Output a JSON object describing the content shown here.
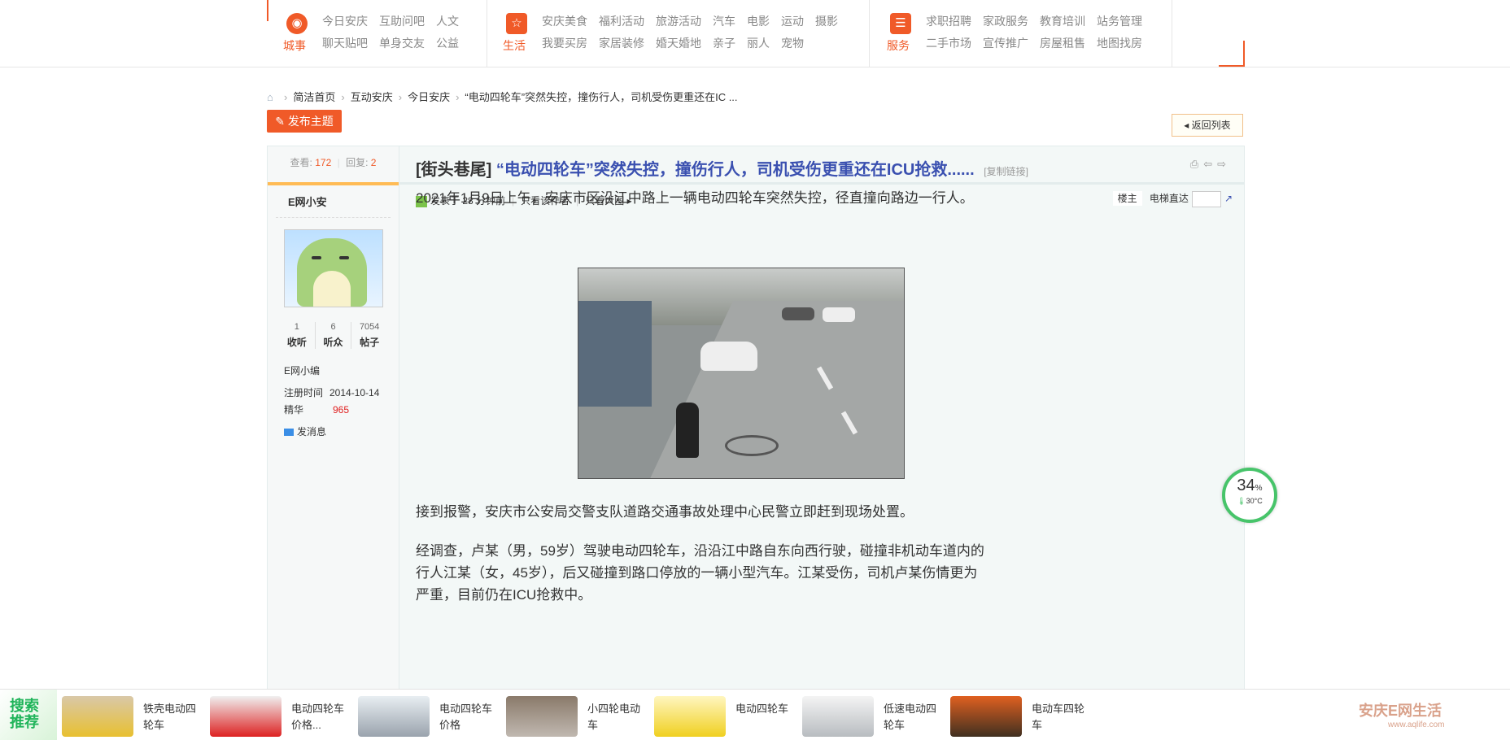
{
  "nav": {
    "groups": [
      {
        "category": "城事",
        "icon": "city-icon",
        "links": [
          "今日安庆",
          "互助问吧",
          "人文",
          "聊天贴吧",
          "单身交友",
          "公益"
        ]
      },
      {
        "category": "生活",
        "icon": "star-icon",
        "links": [
          "安庆美食",
          "福利活动",
          "旅游活动",
          "汽车",
          "电影",
          "运动",
          "摄影",
          "我要买房",
          "家居装修",
          "婚天婚地",
          "亲子",
          "丽人",
          "宠物"
        ]
      },
      {
        "category": "服务",
        "icon": "list-icon",
        "links": [
          "求职招聘",
          "家政服务",
          "教育培训",
          "站务管理",
          "二手市场",
          "宣传推广",
          "房屋租售",
          "地图找房"
        ]
      }
    ]
  },
  "breadcrumb": [
    "简洁首页",
    "互动安庆",
    "今日安庆",
    "“电动四轮车”突然失控，撞伤行人，司机受伤更重还在IC ..."
  ],
  "buttons": {
    "post": "发布主题",
    "back": "返回列表"
  },
  "thread": {
    "views_label": "查看:",
    "views": "172",
    "replies_label": "回复:",
    "replies": "2",
    "tag": "[街头巷尾]",
    "title": "“电动四轮车”突然失控，撞伤行人，司机受伤更重还在ICU抢救......",
    "copy_link": "[复制链接]",
    "posted": "发表于 28 分钟前",
    "only_author": "只看该作者",
    "only_big": "只看大图",
    "floor_label": "楼主",
    "elevator": "电梯直达",
    "paragraphs": [
      "2021年1月9日上午，安庆市区沿江中路上一辆电动四轮车突然失控，径直撞向路边一行人。",
      "接到报警，安庆市公安局交警支队道路交通事故处理中心民警立即赶到现场处置。",
      "经调查，卢某（男，59岁）驾驶电动四轮车，沿沿江中路自东向西行驶，碰撞非机动车道内的行人江某（女，45岁），后又碰撞到路口停放的一辆小型汽车。江某受伤，司机卢某伤情更为严重，目前仍在ICU抢救中。"
    ]
  },
  "author": {
    "name": "E网小安",
    "collect_n": "1",
    "collect_label": "收听",
    "fans_n": "6",
    "fans_label": "听众",
    "posts_n": "7054",
    "posts_label": "帖子",
    "role": "E网小编",
    "reg_label": "注册时间",
    "reg_date": "2014-10-14",
    "digest_label": "精华",
    "digest": "965",
    "message": "发消息"
  },
  "weather": {
    "percent": "34",
    "percent_unit": "%",
    "temp": "30°C"
  },
  "bottom": {
    "search_label": "搜索推荐",
    "items": [
      "铁壳电动四轮车",
      "电动四轮车价格...",
      "电动四轮车价格",
      "小四轮电动车",
      "电动四轮车",
      "低速电动四轮车",
      "电动车四轮车"
    ]
  },
  "logo": {
    "text": "安庆E网生活",
    "url": "www.aqlife.com"
  },
  "colors": {
    "accent": "#f05a28",
    "title": "#3a50b0",
    "green": "#47c46a"
  }
}
